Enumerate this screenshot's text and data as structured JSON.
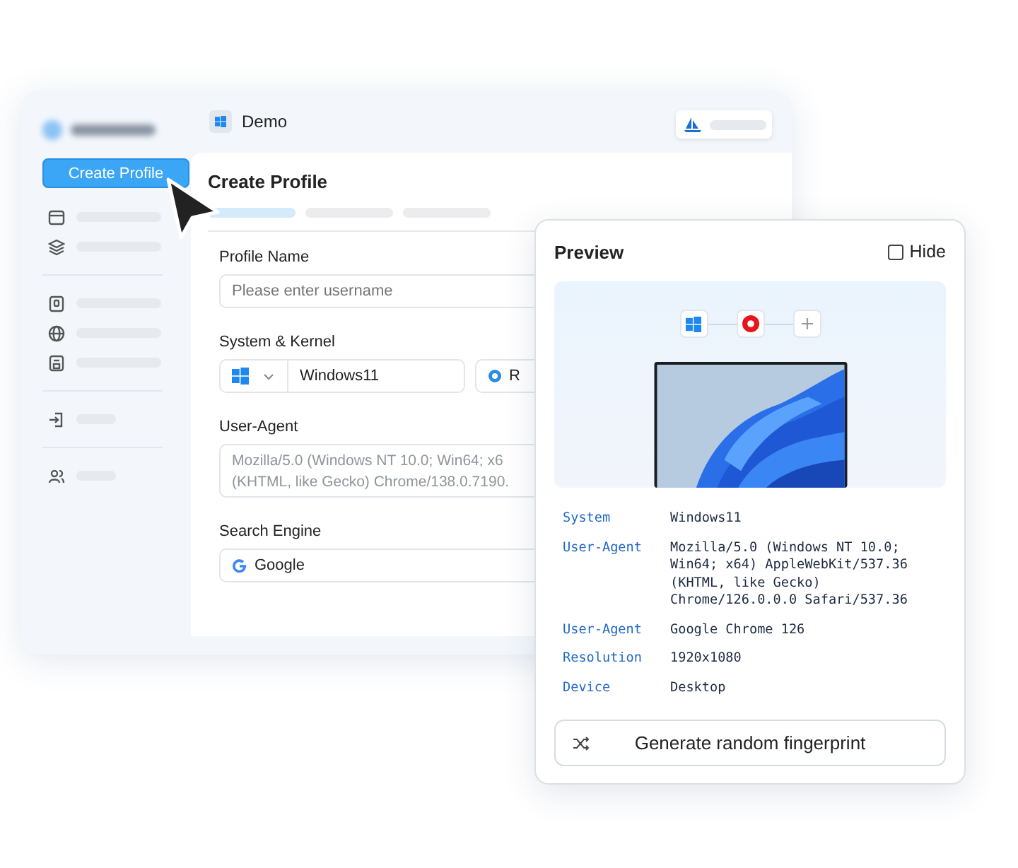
{
  "sidebar": {
    "create_button": "Create Profile"
  },
  "header": {
    "title": "Demo"
  },
  "form": {
    "title": "Create Profile",
    "profile_name": {
      "label": "Profile Name",
      "placeholder": "Please enter username"
    },
    "system_kernel": {
      "label": "System & Kernel",
      "system": "Windows11",
      "kernel": "R"
    },
    "user_agent": {
      "label": "User-Agent",
      "lines": [
        "Mozilla/5.0 (Windows NT 10.0; Win64; x6",
        "(KHTML, like Gecko) Chrome/138.0.7190."
      ]
    },
    "search_engine": {
      "label": "Search Engine",
      "value": "Google"
    }
  },
  "preview": {
    "title": "Preview",
    "hide": {
      "label": "Hide",
      "checked": false
    },
    "rows": [
      {
        "label": "System",
        "value": "Windows11"
      },
      {
        "label": "User-Agent",
        "value": "Mozilla/5.0 (Windows NT 10.0; Win64; x64) AppleWebKit/537.36 (KHTML, like Gecko) Chrome/126.0.0.0 Safari/537.36"
      },
      {
        "label": "User-Agent",
        "value": "Google Chrome 126"
      },
      {
        "label": "Resolution",
        "value": "1920x1080"
      },
      {
        "label": "Device",
        "value": "Desktop"
      }
    ],
    "button": "Generate random fingerprint"
  }
}
